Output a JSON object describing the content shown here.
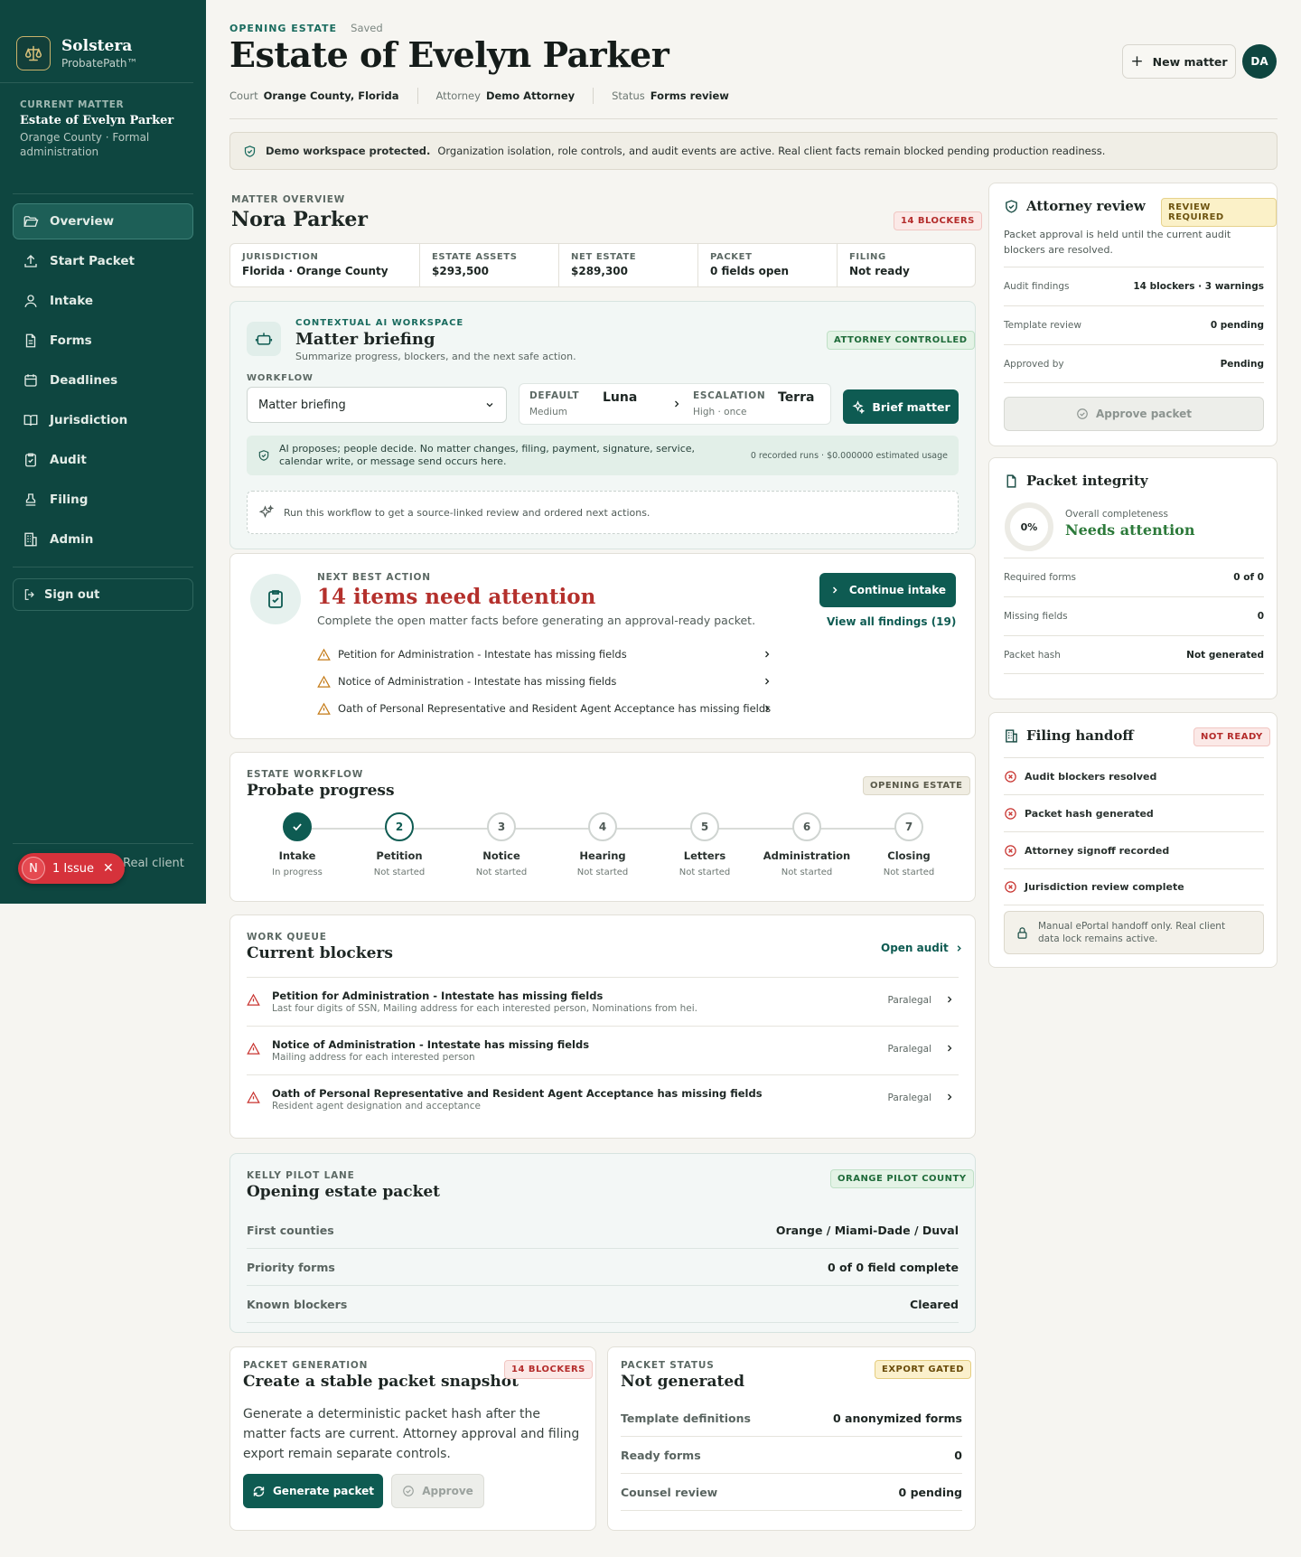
{
  "colors": {
    "sidebar": "#0e4640",
    "accent": "#0e5b52",
    "danger": "#b4302c",
    "success": "#2d7a3b"
  },
  "brand": {
    "name": "Solstera",
    "product": "ProbatePath™",
    "logo_icon": "scales-icon"
  },
  "current_matter": {
    "eyebrow": "CURRENT MATTER",
    "name": "Estate of Evelyn Parker",
    "desc": "Orange County · Formal administration"
  },
  "nav": [
    {
      "label": "Overview",
      "icon": "folder-open-icon",
      "active": true
    },
    {
      "label": "Start Packet",
      "icon": "upload-icon"
    },
    {
      "label": "Intake",
      "icon": "user-icon"
    },
    {
      "label": "Forms",
      "icon": "document-icon"
    },
    {
      "label": "Deadlines",
      "icon": "calendar-icon"
    },
    {
      "label": "Jurisdiction",
      "icon": "book-icon"
    },
    {
      "label": "Audit",
      "icon": "clipboard-check-icon"
    },
    {
      "label": "Filing",
      "icon": "stamp-icon"
    },
    {
      "label": "Admin",
      "icon": "building-icon"
    }
  ],
  "signout": "Sign out",
  "issue_pill": {
    "avatar": "N",
    "label": "1 Issue"
  },
  "real_client_text": "Real client",
  "header": {
    "eyebrow": "OPENING ESTATE",
    "saved": "Saved",
    "title": "Estate of Evelyn Parker",
    "meta": [
      {
        "k": "Court",
        "v": "Orange County, Florida"
      },
      {
        "k": "Attorney",
        "v": "Demo Attorney"
      },
      {
        "k": "Status",
        "v": "Forms review"
      }
    ],
    "new_matter": "New matter",
    "avatar": "DA"
  },
  "banner": {
    "bold": "Demo workspace protected.",
    "text": "Organization isolation, role controls, and audit events are active. Real client facts remain blocked pending production readiness."
  },
  "overview": {
    "eyebrow": "MATTER OVERVIEW",
    "title": "Nora Parker",
    "badge": "14 BLOCKERS",
    "stats": [
      {
        "k": "JURISDICTION",
        "v": "Florida · Orange County"
      },
      {
        "k": "ESTATE ASSETS",
        "v": "$293,500"
      },
      {
        "k": "NET ESTATE",
        "v": "$289,300"
      },
      {
        "k": "PACKET",
        "v": "0 fields open"
      },
      {
        "k": "FILING",
        "v": "Not ready"
      }
    ]
  },
  "ai_workspace": {
    "eyebrow": "CONTEXTUAL AI WORKSPACE",
    "title": "Matter briefing",
    "sub": "Summarize progress, blockers, and the next safe action.",
    "badge": "ATTORNEY CONTROLLED",
    "workflow_label": "WORKFLOW",
    "workflow_value": "Matter briefing",
    "default_label": "DEFAULT",
    "default_sub": "Medium",
    "default_model": "Luna",
    "escalation_label": "ESCALATION",
    "escalation_sub": "High · once",
    "escalation_model": "Terra",
    "brief_button": "Brief matter",
    "notice": "AI proposes; people decide. No matter changes, filing, payment, signature, service, calendar write, or message send occurs here.",
    "usage": "0 recorded runs · $0.000000 estimated usage",
    "run_hint": "Run this workflow to get a source-linked review and ordered next actions."
  },
  "next_action": {
    "eyebrow": "NEXT BEST ACTION",
    "title": "14 items need attention",
    "sub": "Complete the open matter facts before generating an approval-ready packet.",
    "items": [
      "Petition for Administration - Intestate has missing fields",
      "Notice of Administration - Intestate has missing fields",
      "Oath of Personal Representative and Resident Agent Acceptance has missing fields"
    ],
    "continue_button": "Continue intake",
    "view_all": "View all findings (19)"
  },
  "progress": {
    "eyebrow": "ESTATE WORKFLOW",
    "title": "Probate progress",
    "badge": "OPENING ESTATE",
    "steps": [
      {
        "num": "✓",
        "name": "Intake",
        "status": "In progress",
        "state": "done"
      },
      {
        "num": "2",
        "name": "Petition",
        "status": "Not started",
        "state": "cur"
      },
      {
        "num": "3",
        "name": "Notice",
        "status": "Not started",
        "state": ""
      },
      {
        "num": "4",
        "name": "Hearing",
        "status": "Not started",
        "state": ""
      },
      {
        "num": "5",
        "name": "Letters",
        "status": "Not started",
        "state": ""
      },
      {
        "num": "6",
        "name": "Administration",
        "status": "Not started",
        "state": ""
      },
      {
        "num": "7",
        "name": "Closing",
        "status": "Not started",
        "state": ""
      }
    ]
  },
  "blockers": {
    "eyebrow": "WORK QUEUE",
    "title": "Current blockers",
    "open_audit": "Open audit",
    "rows": [
      {
        "title": "Petition for Administration - Intestate has missing fields",
        "desc": "Last four digits of SSN, Mailing address for each interested person, Nominations from hei...",
        "who": "Paralegal"
      },
      {
        "title": "Notice of Administration - Intestate has missing fields",
        "desc": "Mailing address for each interested person",
        "who": "Paralegal"
      },
      {
        "title": "Oath of Personal Representative and Resident Agent Acceptance has missing fields",
        "desc": "Resident agent designation and acceptance",
        "who": "Paralegal"
      }
    ]
  },
  "kelly": {
    "eyebrow": "KELLY PILOT LANE",
    "title": "Opening estate packet",
    "badge": "ORANGE PILOT COUNTY",
    "rows": [
      {
        "k": "First counties",
        "v": "Orange / Miami-Dade / Duval"
      },
      {
        "k": "Priority forms",
        "v": "0 of 0 field complete"
      },
      {
        "k": "Known blockers",
        "v": "Cleared"
      }
    ]
  },
  "packet_gen": {
    "eyebrow": "PACKET GENERATION",
    "title": "Create a stable packet snapshot",
    "badge": "14 BLOCKERS",
    "desc": "Generate a deterministic packet hash after the matter facts are current. Attorney approval and filing export remain separate controls.",
    "generate": "Generate packet",
    "approve": "Approve"
  },
  "packet_status": {
    "eyebrow": "PACKET STATUS",
    "title": "Not generated",
    "badge": "EXPORT GATED",
    "rows": [
      {
        "k": "Template definitions",
        "v": "0 anonymized forms"
      },
      {
        "k": "Ready forms",
        "v": "0"
      },
      {
        "k": "Counsel review",
        "v": "0 pending"
      }
    ]
  },
  "attorney_review": {
    "title": "Attorney review",
    "badge": "REVIEW REQUIRED",
    "desc": "Packet approval is held until the current audit blockers are resolved.",
    "rows": [
      {
        "k": "Audit findings",
        "v": "14 blockers · 3 warnings"
      },
      {
        "k": "Template review",
        "v": "0 pending"
      },
      {
        "k": "Approved by",
        "v": "Pending"
      }
    ],
    "approve": "Approve packet"
  },
  "integrity": {
    "title": "Packet integrity",
    "completeness_pct": 0,
    "completeness_label": "0%",
    "overall_label": "Overall completeness",
    "overall_value": "Needs attention",
    "rows": [
      {
        "k": "Required forms",
        "v": "0 of 0"
      },
      {
        "k": "Missing fields",
        "v": "0"
      },
      {
        "k": "Packet hash",
        "v": "Not generated"
      }
    ]
  },
  "filing_handoff": {
    "title": "Filing handoff",
    "badge": "NOT READY",
    "rows": [
      "Audit blockers resolved",
      "Packet hash generated",
      "Attorney signoff recorded",
      "Jurisdiction review complete"
    ],
    "note": "Manual ePortal handoff only. Real client data lock remains active."
  }
}
